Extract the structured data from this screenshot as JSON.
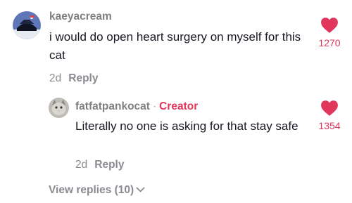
{
  "comments": [
    {
      "username": "kaeyacream",
      "text": "i would do open heart surgery on myself for this cat",
      "age": "2d",
      "reply_label": "Reply",
      "like_count": "1270",
      "liked": true
    },
    {
      "username": "fatfatpankocat",
      "separator": "·",
      "badge": "Creator",
      "text": "Literally no one is asking for that stay safe",
      "age": "2d",
      "reply_label": "Reply",
      "like_count": "1354",
      "liked": true
    }
  ],
  "view_replies_label": "View replies (10)",
  "colors": {
    "accent": "#e0365c",
    "text": "#161823",
    "muted": "#8a8b91"
  },
  "icons": {
    "like": "heart-icon",
    "expand": "chevron-down-icon"
  }
}
